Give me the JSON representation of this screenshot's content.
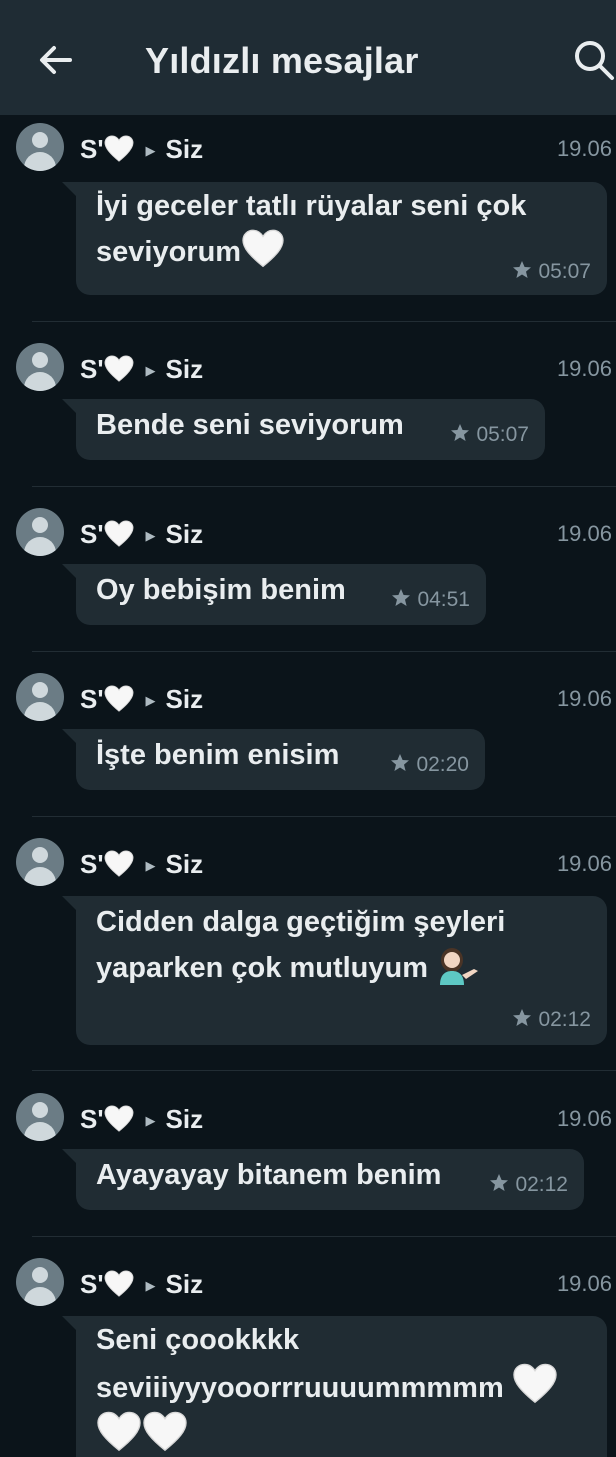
{
  "header": {
    "title": "Yıldızlı mesajlar"
  },
  "icons": {
    "back": "arrow-left-icon",
    "search": "search-icon",
    "star": "star-icon",
    "heart": "white-heart-emoji",
    "avatar": "default-avatar-icon"
  },
  "colors": {
    "background": "#0b141a",
    "header": "#1f2c34",
    "bubble": "#202c33",
    "muted": "#8696a0"
  },
  "messages": [
    {
      "sender": "S'",
      "recipient": "Siz",
      "date": "19.06",
      "text_line1": "İyi geceler tatlı rüyalar seni çok",
      "text_line2": "seviyorum",
      "time": "05:07"
    },
    {
      "sender": "S'",
      "recipient": "Siz",
      "date": "19.06",
      "text": "Bende seni seviyorum",
      "time": "05:07"
    },
    {
      "sender": "S'",
      "recipient": "Siz",
      "date": "19.06",
      "text": "Oy bebişim benim",
      "time": "04:51"
    },
    {
      "sender": "S'",
      "recipient": "Siz",
      "date": "19.06",
      "text": "İşte benim enisim",
      "time": "02:20"
    },
    {
      "sender": "S'",
      "recipient": "Siz",
      "date": "19.06",
      "text_line1": "Cidden dalga geçtiğim şeyleri",
      "text_line2": "yaparken çok mutluyum",
      "time": "02:12"
    },
    {
      "sender": "S'",
      "recipient": "Siz",
      "date": "19.06",
      "text": "Ayayayay bitanem benim",
      "time": "02:12"
    },
    {
      "sender": "S'",
      "recipient": "Siz",
      "date": "19.06",
      "text_line1": "Seni çoookkkk",
      "text_line2": "seviiiyyyooorrruuuummmmm"
    }
  ]
}
